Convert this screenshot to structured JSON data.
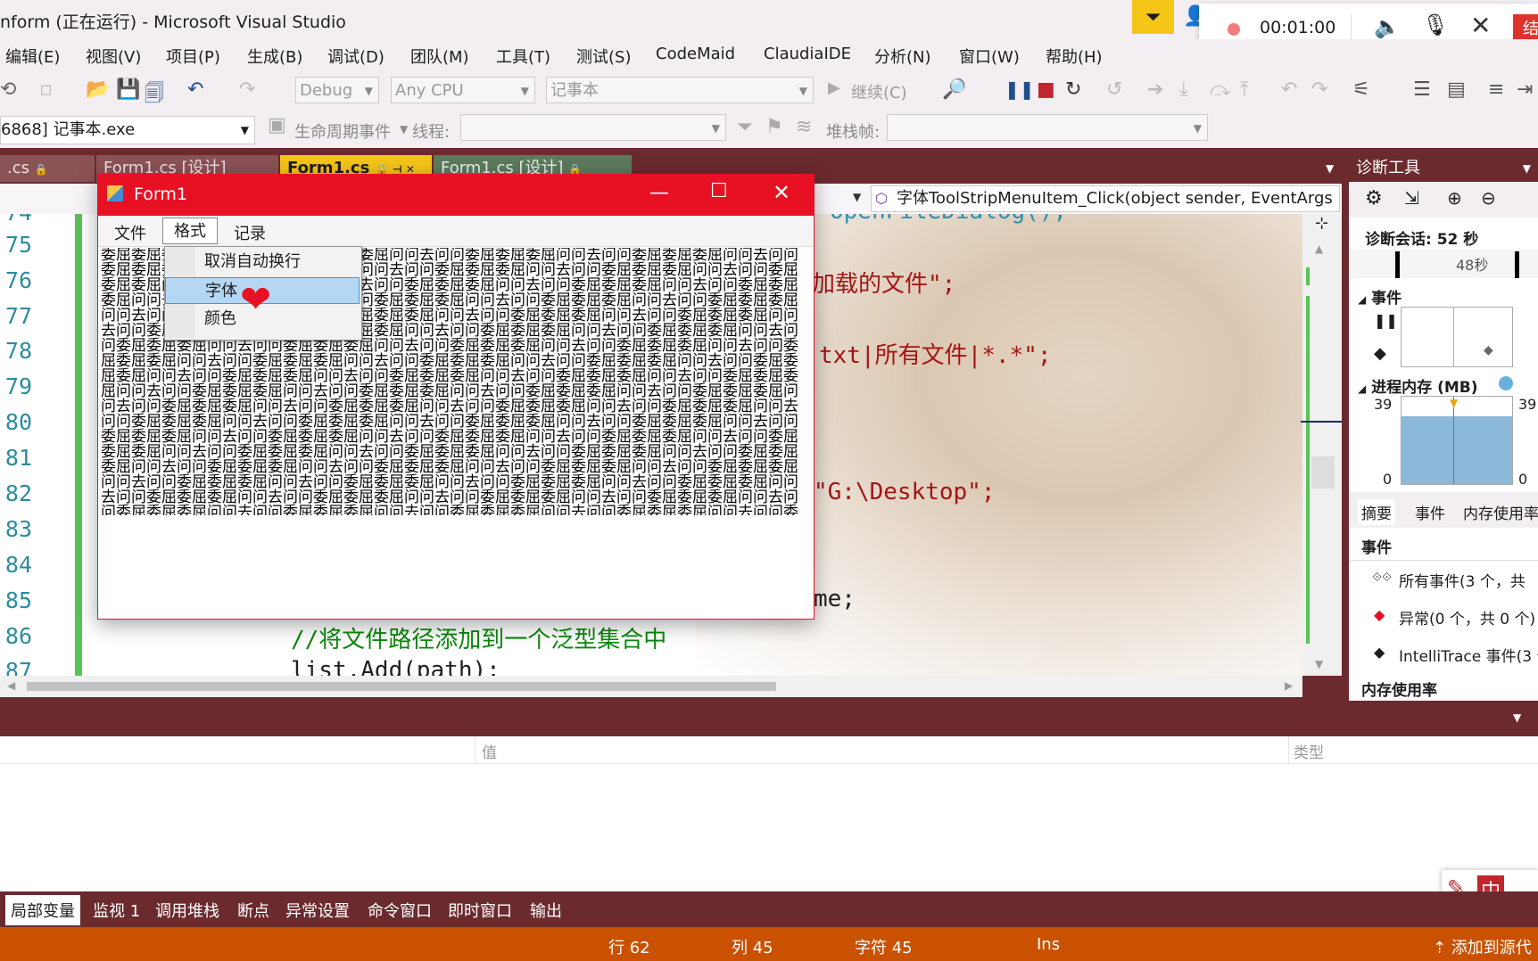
{
  "window": {
    "title": "nform (正在运行) - Microsoft Visual Studio"
  },
  "recorder": {
    "time": "00:01:00",
    "end_label": "结"
  },
  "menu": [
    "编辑(E)",
    "视图(V)",
    "项目(P)",
    "生成(B)",
    "调试(D)",
    "团队(M)",
    "工具(T)",
    "测试(S)",
    "CodeMaid",
    "ClaudiaIDE",
    "分析(N)",
    "窗口(W)",
    "帮助(H)"
  ],
  "toolbar": {
    "config": "Debug",
    "platform": "Any CPU",
    "startup": "记事本",
    "continue": "继续(C)"
  },
  "toolbar2": {
    "process": "6868] 记事本.exe",
    "lifecycle": "生命周期事件",
    "thread_label": "线程:",
    "stack_label": "堆栈帧:"
  },
  "tabs": [
    "Form1.cs [设计]",
    "Form1.cs",
    "Form1.cs [设计]"
  ],
  "tab_left": ".cs",
  "nav": {
    "method": "字体ToolStripMenuItem_Click(object sender, EventArgs"
  },
  "line_numbers": [
    "74",
    "75",
    "76",
    "77",
    "78",
    "79",
    "80",
    "81",
    "82",
    "83",
    "84",
    "85",
    "86",
    "87"
  ],
  "code": {
    "l75": "OpenFileDialog();",
    "l76": "加载的文件\";",
    "l78": "txt|所有文件|*.*\";",
    "l82": "\"G:\\Desktop\";",
    "l85": "me;",
    "l86": "//将文件路径添加到一个泛型集合中",
    "l87": "list.Add(path);"
  },
  "form1": {
    "title": "Form1",
    "menu": [
      "文件",
      "格式",
      "记录"
    ],
    "dropdown": [
      "取消自动换行",
      "字体",
      "颜色"
    ],
    "content": "委屈委屈委屈委屈问问去问问委屈委屈委屈问问去问问委屈委屈委屈问问去问问委屈委屈委屈问问去问问委屈委屈委屈问问去问问委屈委屈委屈问问去问问委屈委屈委屈问问去问问委屈委屈委屈问问去问问委屈委屈委屈问问去问问委屈委屈委屈问问去问问委屈委屈委屈问问去问问委屈委屈委屈问问去问问委屈委屈委屈问问去问问委屈委屈委屈问问去问问委屈委屈委屈问问去问问委屈委屈委屈问问去问问委屈委屈委屈问问去问问委屈委屈委屈问问去问问委屈委屈委屈问问去问问委屈委屈委屈问问去问问委屈委屈委屈问问去问问委屈委屈委屈问问去问问委屈委屈委屈问问去问问委屈委屈委屈问问去问问委屈委屈委屈问问去问问委屈委屈委屈问问去问问委屈委屈委屈问问去问问委屈委屈委屈问问去问问委屈委屈委屈问问去问问委屈委屈委屈问问去问问委屈委屈委屈问问去问问委屈委屈委屈问问去问问委屈委屈委屈问问去问问委屈委屈委屈问问去问问委屈委屈委屈问问去问问委屈委屈委屈问问去问问委屈委屈委屈问问去问问委屈委屈委屈问问去问问委屈委屈委屈问问去问问委屈委屈委屈问问去问问委屈委屈委屈问问去问问委屈委屈委屈问问去问问委屈委屈委屈问问去问问委屈委屈委屈问问去问问委屈委屈委屈问问去问问委屈委屈委屈问问去问问委屈委屈委屈问问去问问委屈委屈委屈问问去问问委屈委屈委屈问问去问问委屈委屈委屈问问去问问委屈委屈委屈问问去问问委屈委屈委屈问问去问问委屈委屈委屈问问去问问委屈委屈委屈问问去问问委屈委屈委屈问问去问问委屈委屈委屈问问去问问委屈委屈委屈问问去问问委屈委屈委屈问问去问问委屈委屈委屈问问去问问委屈委屈委屈问问去问问委屈委屈委屈问问去问问委屈委屈委屈问问去问问委屈委屈委屈问问去问问委屈委屈委屈问问去问问委屈委屈委屈问问去问问委屈委屈委屈问问去问问委屈委屈委屈问问去问问委屈委屈委屈问问去问问委屈委屈委屈问问去问问委屈委屈委屈问问去问问委屈委屈委屈问问去问问委屈委屈委屈问问去问问委屈委屈委屈问问去问问委屈委屈委屈问问去问问委屈委屈委屈问问去问问委屈委屈委屈问问去问问委屈委屈委屈问问去问问委屈委屈委屈问问去问问委屈委屈委屈问问去问问委屈委屈委屈问问去问问委屈委屈委屈问问去问问委屈委屈委屈问问去问问委屈委屈委屈问问去问问委屈委屈委屈问问去问问委屈委屈委屈问问去问问委屈委屈委屈问问去问问委屈委屈委屈问问去问问委屈委屈委屈问问去问问委屈委屈委屈问问去问问委屈委屈委屈问问去问问"
  },
  "diag": {
    "title": "诊断工具",
    "session": "诊断会话: 52 秒",
    "timeline": "48秒",
    "events_label": "事件",
    "memory_label": "进程内存 (MB)",
    "mem_max": "39",
    "mem_min": "0",
    "tabs": [
      "摘要",
      "事件",
      "内存使用率"
    ],
    "section": "事件",
    "rows": [
      "所有事件(3 个，共",
      "异常(0 个，共 0 个)",
      "IntelliTrace 事件(3 个"
    ],
    "footer": "内存使用率"
  },
  "bottom": {
    "col_value": "值",
    "col_type": "类型",
    "tabs": [
      "局部变量",
      "监视 1",
      "调用堆栈",
      "断点",
      "异常设置",
      "命令窗口",
      "即时窗口",
      "输出"
    ]
  },
  "ime": "中",
  "status": {
    "line": "行 62",
    "col": "列 45",
    "ch": "字符 45",
    "ins": "Ins",
    "source": "添加到源代"
  },
  "colors": {
    "accent": "#ca5100",
    "frame": "#6b2a2e",
    "form_title": "#e81123",
    "code_green": "#0a8a0a",
    "code_string": "#a31515"
  }
}
